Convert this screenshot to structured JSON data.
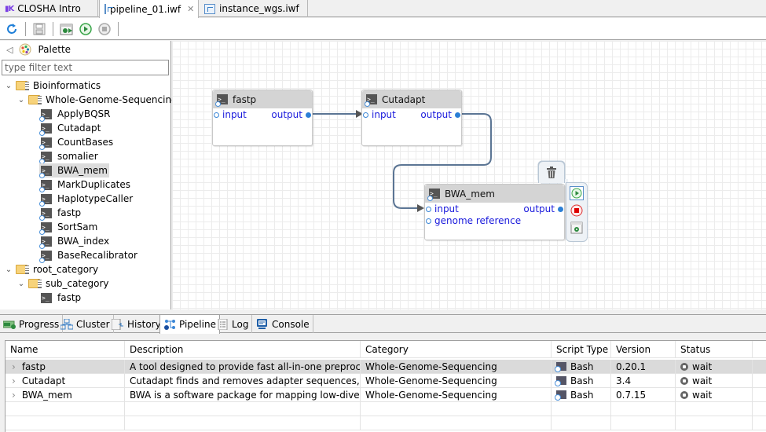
{
  "editor_tabs": [
    {
      "label": "CLOSHA Intro",
      "icon": "closha-logo-icon",
      "active": false
    },
    {
      "label": "pipeline_01.iwf",
      "icon": "workflow-file-icon",
      "active": true,
      "closable": true,
      "close_glyph": "✕"
    },
    {
      "label": "instance_wgs.iwf",
      "icon": "workflow-file-icon",
      "active": false
    }
  ],
  "toolbar": {
    "buttons": [
      "refresh-icon",
      "save-icon",
      "deploy-icon",
      "run-icon",
      "stop-icon"
    ]
  },
  "palette": {
    "title": "Palette",
    "collapse_glyph": "◁",
    "filter_placeholder": "type filter text",
    "tree": [
      {
        "label": "Bioinformatics",
        "level": 0,
        "type": "category",
        "expanded": true
      },
      {
        "label": "Whole-Genome-Sequencing",
        "level": 1,
        "type": "subcategory",
        "expanded": true
      },
      {
        "label": "ApplyBQSR",
        "level": 2,
        "type": "tool"
      },
      {
        "label": "Cutadapt",
        "level": 2,
        "type": "tool"
      },
      {
        "label": "CountBases",
        "level": 2,
        "type": "tool"
      },
      {
        "label": "somalier",
        "level": 2,
        "type": "tool"
      },
      {
        "label": "BWA_mem",
        "level": 2,
        "type": "tool",
        "selected": true
      },
      {
        "label": "MarkDuplicates",
        "level": 2,
        "type": "tool"
      },
      {
        "label": "HaplotypeCaller",
        "level": 2,
        "type": "tool"
      },
      {
        "label": "fastp",
        "level": 2,
        "type": "tool"
      },
      {
        "label": "SortSam",
        "level": 2,
        "type": "tool"
      },
      {
        "label": "BWA_index",
        "level": 2,
        "type": "tool"
      },
      {
        "label": "BaseRecalibrator",
        "level": 2,
        "type": "tool"
      },
      {
        "label": "root_category",
        "level": 0,
        "type": "category",
        "expanded": true
      },
      {
        "label": "sub_category",
        "level": 1,
        "type": "subcategory",
        "expanded": true
      },
      {
        "label": "fastp",
        "level": 2,
        "type": "tool-plain"
      }
    ]
  },
  "canvas": {
    "nodes": [
      {
        "name": "fastp",
        "inputs": [
          "input"
        ],
        "outputs": [
          "output"
        ]
      },
      {
        "name": "Cutadapt",
        "inputs": [
          "input"
        ],
        "outputs": [
          "output"
        ]
      },
      {
        "name": "BWA_mem",
        "inputs": [
          "input",
          "genome reference"
        ],
        "outputs": [
          "output"
        ]
      }
    ],
    "connections": [
      {
        "from": "fastp.output",
        "to": "Cutadapt.input"
      },
      {
        "from": "Cutadapt.output",
        "to": "BWA_mem.input"
      }
    ],
    "node_actions": [
      "delete-icon",
      "run-icon",
      "stop-icon",
      "settings-icon"
    ]
  },
  "bottom_tabs": [
    {
      "label": "Progress",
      "icon": "progress-icon"
    },
    {
      "label": "Cluster",
      "icon": "cluster-icon"
    },
    {
      "label": "History",
      "icon": "history-icon"
    },
    {
      "label": "Pipeline",
      "icon": "pipeline-icon",
      "active": true
    },
    {
      "label": "Log",
      "icon": "log-icon"
    },
    {
      "label": "Console",
      "icon": "console-icon"
    }
  ],
  "pipeline_table": {
    "columns": [
      "Name",
      "Description",
      "Category",
      "Script Type",
      "Version",
      "Status"
    ],
    "rows": [
      {
        "name": "fastp",
        "description": "A tool designed to provide fast all-in-one preproces...",
        "category": "Whole-Genome-Sequencing",
        "script_type": "Bash",
        "version": "0.20.1",
        "status": "wait",
        "selected": true
      },
      {
        "name": "Cutadapt",
        "description": "Cutadapt finds and removes adapter sequences, pri...",
        "category": "Whole-Genome-Sequencing",
        "script_type": "Bash",
        "version": "3.4",
        "status": "wait"
      },
      {
        "name": "BWA_mem",
        "description": "BWA is a software package for mapping low-diverge...",
        "category": "Whole-Genome-Sequencing",
        "script_type": "Bash",
        "version": "0.7.15",
        "status": "wait"
      }
    ],
    "expander_glyph": "›"
  },
  "colors": {
    "port_label": "#1a1adc",
    "port_dot": "#2b7fd6",
    "edge": "#5b7594",
    "node_header": "#d4d4d4",
    "selection": "#dadada"
  }
}
